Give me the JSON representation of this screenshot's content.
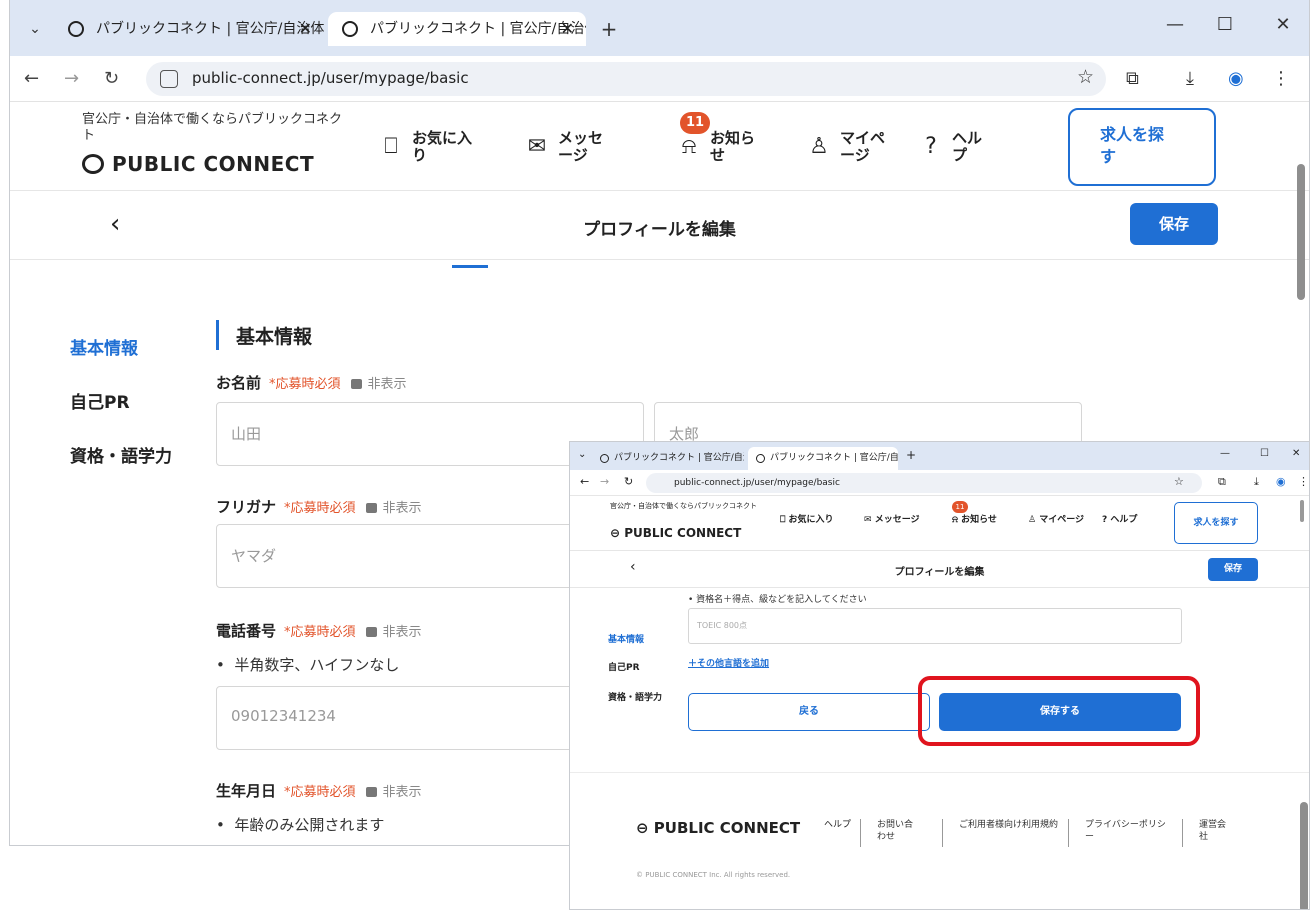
{
  "browser": {
    "tabs": [
      {
        "title": "パブリックコネクト | 官公庁/自治体",
        "active": false
      },
      {
        "title": "パブリックコネクト | 官公庁/自治体",
        "active": true
      }
    ],
    "new_tab": "+",
    "url": "public-connect.jp/user/mypage/basic",
    "window_controls": {
      "minimize": "—",
      "maximize": "☐",
      "close": "✕"
    }
  },
  "site": {
    "tagline": "官公庁・自治体で働くならパブリックコネクト",
    "logo": "PUBLIC CONNECT",
    "nav": [
      {
        "label": "お気に入り",
        "icon": "bookmark-icon"
      },
      {
        "label": "メッセージ",
        "icon": "mail-icon"
      },
      {
        "label": "お知らせ",
        "icon": "bell-icon"
      },
      {
        "label": "マイページ",
        "icon": "user-icon"
      },
      {
        "label": "ヘルプ",
        "icon": "help-icon"
      }
    ],
    "notification_count": "11",
    "search_jobs": "求人を探す"
  },
  "edit_bar": {
    "back": "‹",
    "title": "プロフィールを編集",
    "save": "保存"
  },
  "sidebar": {
    "items": [
      {
        "label": "基本情報",
        "active": true
      },
      {
        "label": "自己PR",
        "active": false
      },
      {
        "label": "資格・語学力",
        "active": false
      }
    ]
  },
  "form": {
    "section_title": "基本情報",
    "required_text": "*応募時必須",
    "hidden_text": "非表示",
    "name": {
      "label": "お名前",
      "last_placeholder": "山田",
      "first_placeholder": "太郎"
    },
    "furigana": {
      "label": "フリガナ",
      "placeholder": "ヤマダ"
    },
    "phone": {
      "label": "電話番号",
      "hint": "半角数字、ハイフンなし",
      "placeholder": "09012341234"
    },
    "birthday": {
      "label": "生年月日",
      "hint": "年齢のみ公開されます"
    }
  },
  "overlay": {
    "qual_hint": "資格名＋得点、級などを記入してください",
    "qual_placeholder": "TOEIC 800点",
    "add_language": "＋その他言語を追加",
    "back_button": "戻る",
    "submit_button": "保存する",
    "footer_logo": "PUBLIC CONNECT",
    "footer_links": [
      "ヘルプ",
      "お問い合わせ",
      "ご利用者様向け利用規約",
      "プライバシーポリシー",
      "運営会社"
    ],
    "copyright": "© PUBLIC CONNECT Inc. All rights reserved."
  },
  "colors": {
    "accent": "#1f6fd4",
    "required": "#e2542b",
    "highlight": "#e0141e"
  }
}
